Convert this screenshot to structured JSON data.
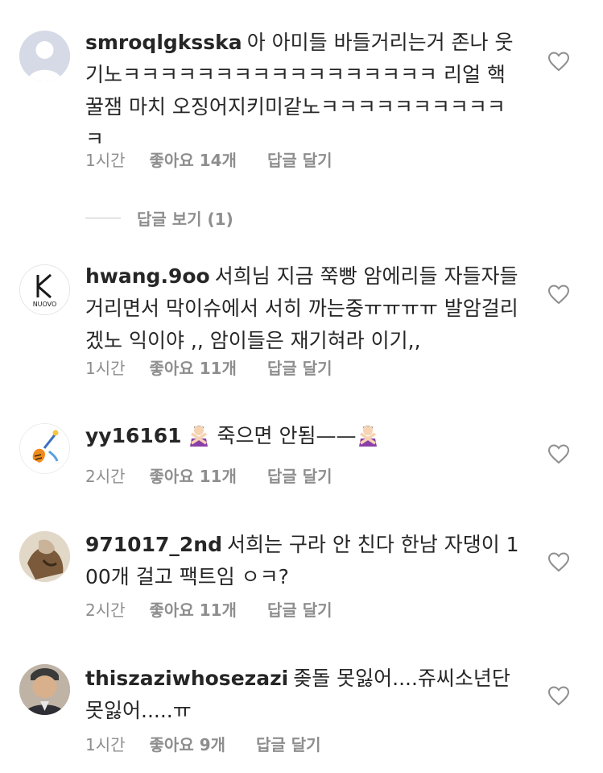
{
  "comments": [
    {
      "username": "smroqlgksska",
      "text": "아 아미들 바들거리는거 존나 웃기노ㅋㅋㅋㅋㅋㅋㅋㅋㅋㅋㅋㅋㅋㅋㅋㅋㅋ 리얼 핵꿀잼 마치 오징어지키미같노ㅋㅋㅋㅋㅋㅋㅋㅋㅋㅋㅋ",
      "time": "1시간",
      "likes": "좋아요 14개",
      "reply": "답글 달기"
    },
    {
      "username": "hwang.9oo",
      "text": "서희님 지금 쭉빵 암에리들 자들자들 거리면서 막이슈에서 서히 까는중ㅠㅠㅠㅠ 발암걸리겠노 익이야 ,, 암이들은  재기혀라 이기,,",
      "time": "1시간",
      "likes": "좋아요 11개",
      "reply": "답글 달기",
      "avatar_label": "NUOVO"
    },
    {
      "username": "yy16161",
      "text": "죽으면 안됨——",
      "time": "2시간",
      "likes": "좋아요 11개",
      "reply": "답글 달기"
    },
    {
      "username": "971017_2nd",
      "text": "서희는 구라 안 친다 한남 자댕이 100개 걸고 팩트임 ㅇㅋ?",
      "time": "2시간",
      "likes": "좋아요 11개",
      "reply": "답글 달기"
    },
    {
      "username": "thiszaziwhosezazi",
      "text": "좆돌 못잃어....쥬씨소년단 못잃어.....ㅠ",
      "time": "1시간",
      "likes": "좋아요 9개",
      "reply": "답글 달기"
    }
  ],
  "view_replies": "답글 보기 (1)",
  "icons": {
    "like": "heart-outline-icon",
    "emoji": "person-gesturing-no-emoji"
  },
  "colors": {
    "text": "#262626",
    "secondary": "#8e8e8e"
  }
}
